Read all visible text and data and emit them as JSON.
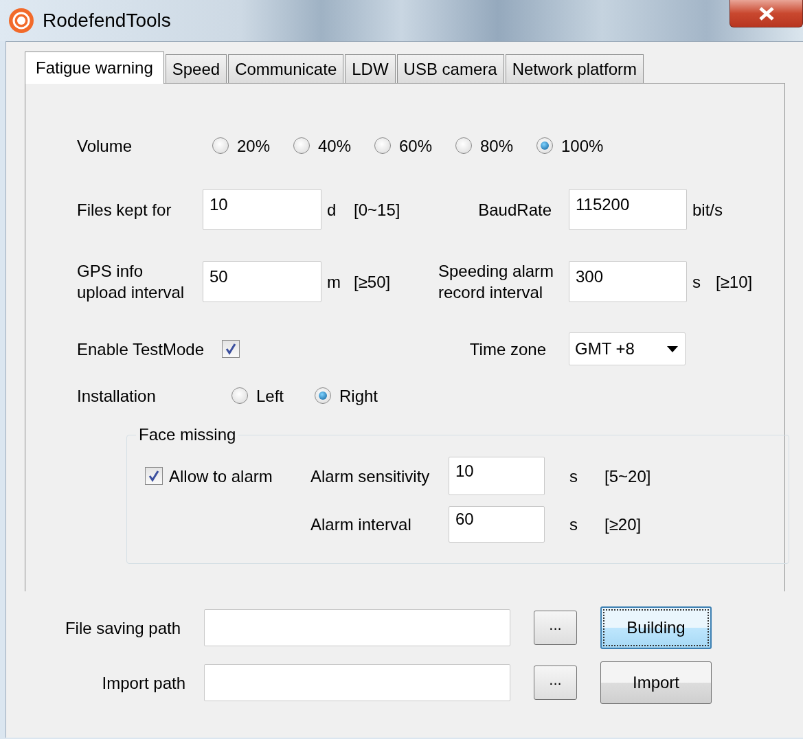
{
  "window": {
    "title": "RodefendTools"
  },
  "tabs": [
    {
      "label": "Fatigue warning",
      "selected": true
    },
    {
      "label": "Speed",
      "selected": false
    },
    {
      "label": "Communicate",
      "selected": false
    },
    {
      "label": "LDW",
      "selected": false
    },
    {
      "label": "USB camera",
      "selected": false
    },
    {
      "label": "Network platform",
      "selected": false
    }
  ],
  "volume": {
    "label": "Volume",
    "options": [
      {
        "label": "20%",
        "selected": false
      },
      {
        "label": "40%",
        "selected": false
      },
      {
        "label": "60%",
        "selected": false
      },
      {
        "label": "80%",
        "selected": false
      },
      {
        "label": "100%",
        "selected": true
      }
    ]
  },
  "files_kept": {
    "label": "Files kept for",
    "value": "10",
    "unit": "d",
    "range": "[0~15]"
  },
  "baud_rate": {
    "label": "BaudRate",
    "value": "115200",
    "unit": "bit/s"
  },
  "gps_interval": {
    "label": "GPS info\nupload interval",
    "value": "50",
    "unit": "m",
    "range": "[≥50]"
  },
  "speeding_interval": {
    "label": "Speeding alarm\nrecord interval",
    "value": "300",
    "unit": "s",
    "range": "[≥10]"
  },
  "test_mode": {
    "label": "Enable TestMode",
    "checked": true
  },
  "time_zone": {
    "label": "Time zone",
    "value": "GMT +8"
  },
  "installation": {
    "label": "Installation",
    "options": [
      {
        "label": "Left",
        "selected": false
      },
      {
        "label": "Right",
        "selected": true
      }
    ]
  },
  "face_missing": {
    "title": "Face missing",
    "allow_alarm": {
      "label": "Allow to alarm",
      "checked": true
    },
    "sensitivity": {
      "label": "Alarm sensitivity",
      "value": "10",
      "unit": "s",
      "range": "[5~20]"
    },
    "interval": {
      "label": "Alarm interval",
      "value": "60",
      "unit": "s",
      "range": "[≥20]"
    }
  },
  "paths": [
    {
      "label": "File saving path",
      "browse": "...",
      "button": {
        "label": "Building",
        "focused": true
      }
    },
    {
      "label": "Import path",
      "browse": "...",
      "button": {
        "label": "Import",
        "focused": false
      }
    }
  ]
}
